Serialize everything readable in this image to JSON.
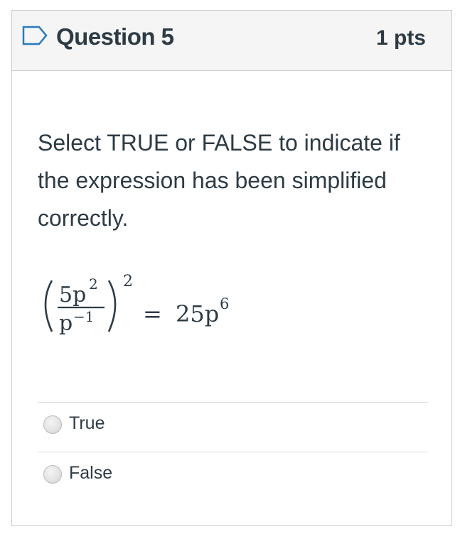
{
  "question": {
    "title": "Question 5",
    "points": "1 pts",
    "prompt": "Select TRUE or FALSE to indicate if the expression has been simplified correctly.",
    "icons": {
      "flag": "flag-outline-icon",
      "radio": "radio-unselected-icon"
    },
    "formula": {
      "numerator_coefficient": "5p",
      "numerator_exponent": "2",
      "denominator_base": "p",
      "denominator_exponent": "−1",
      "outer_exponent": "2",
      "equals": "=",
      "result_coefficient": "25p",
      "result_exponent": "6"
    },
    "answers": [
      {
        "label": "True"
      },
      {
        "label": "False"
      }
    ]
  }
}
